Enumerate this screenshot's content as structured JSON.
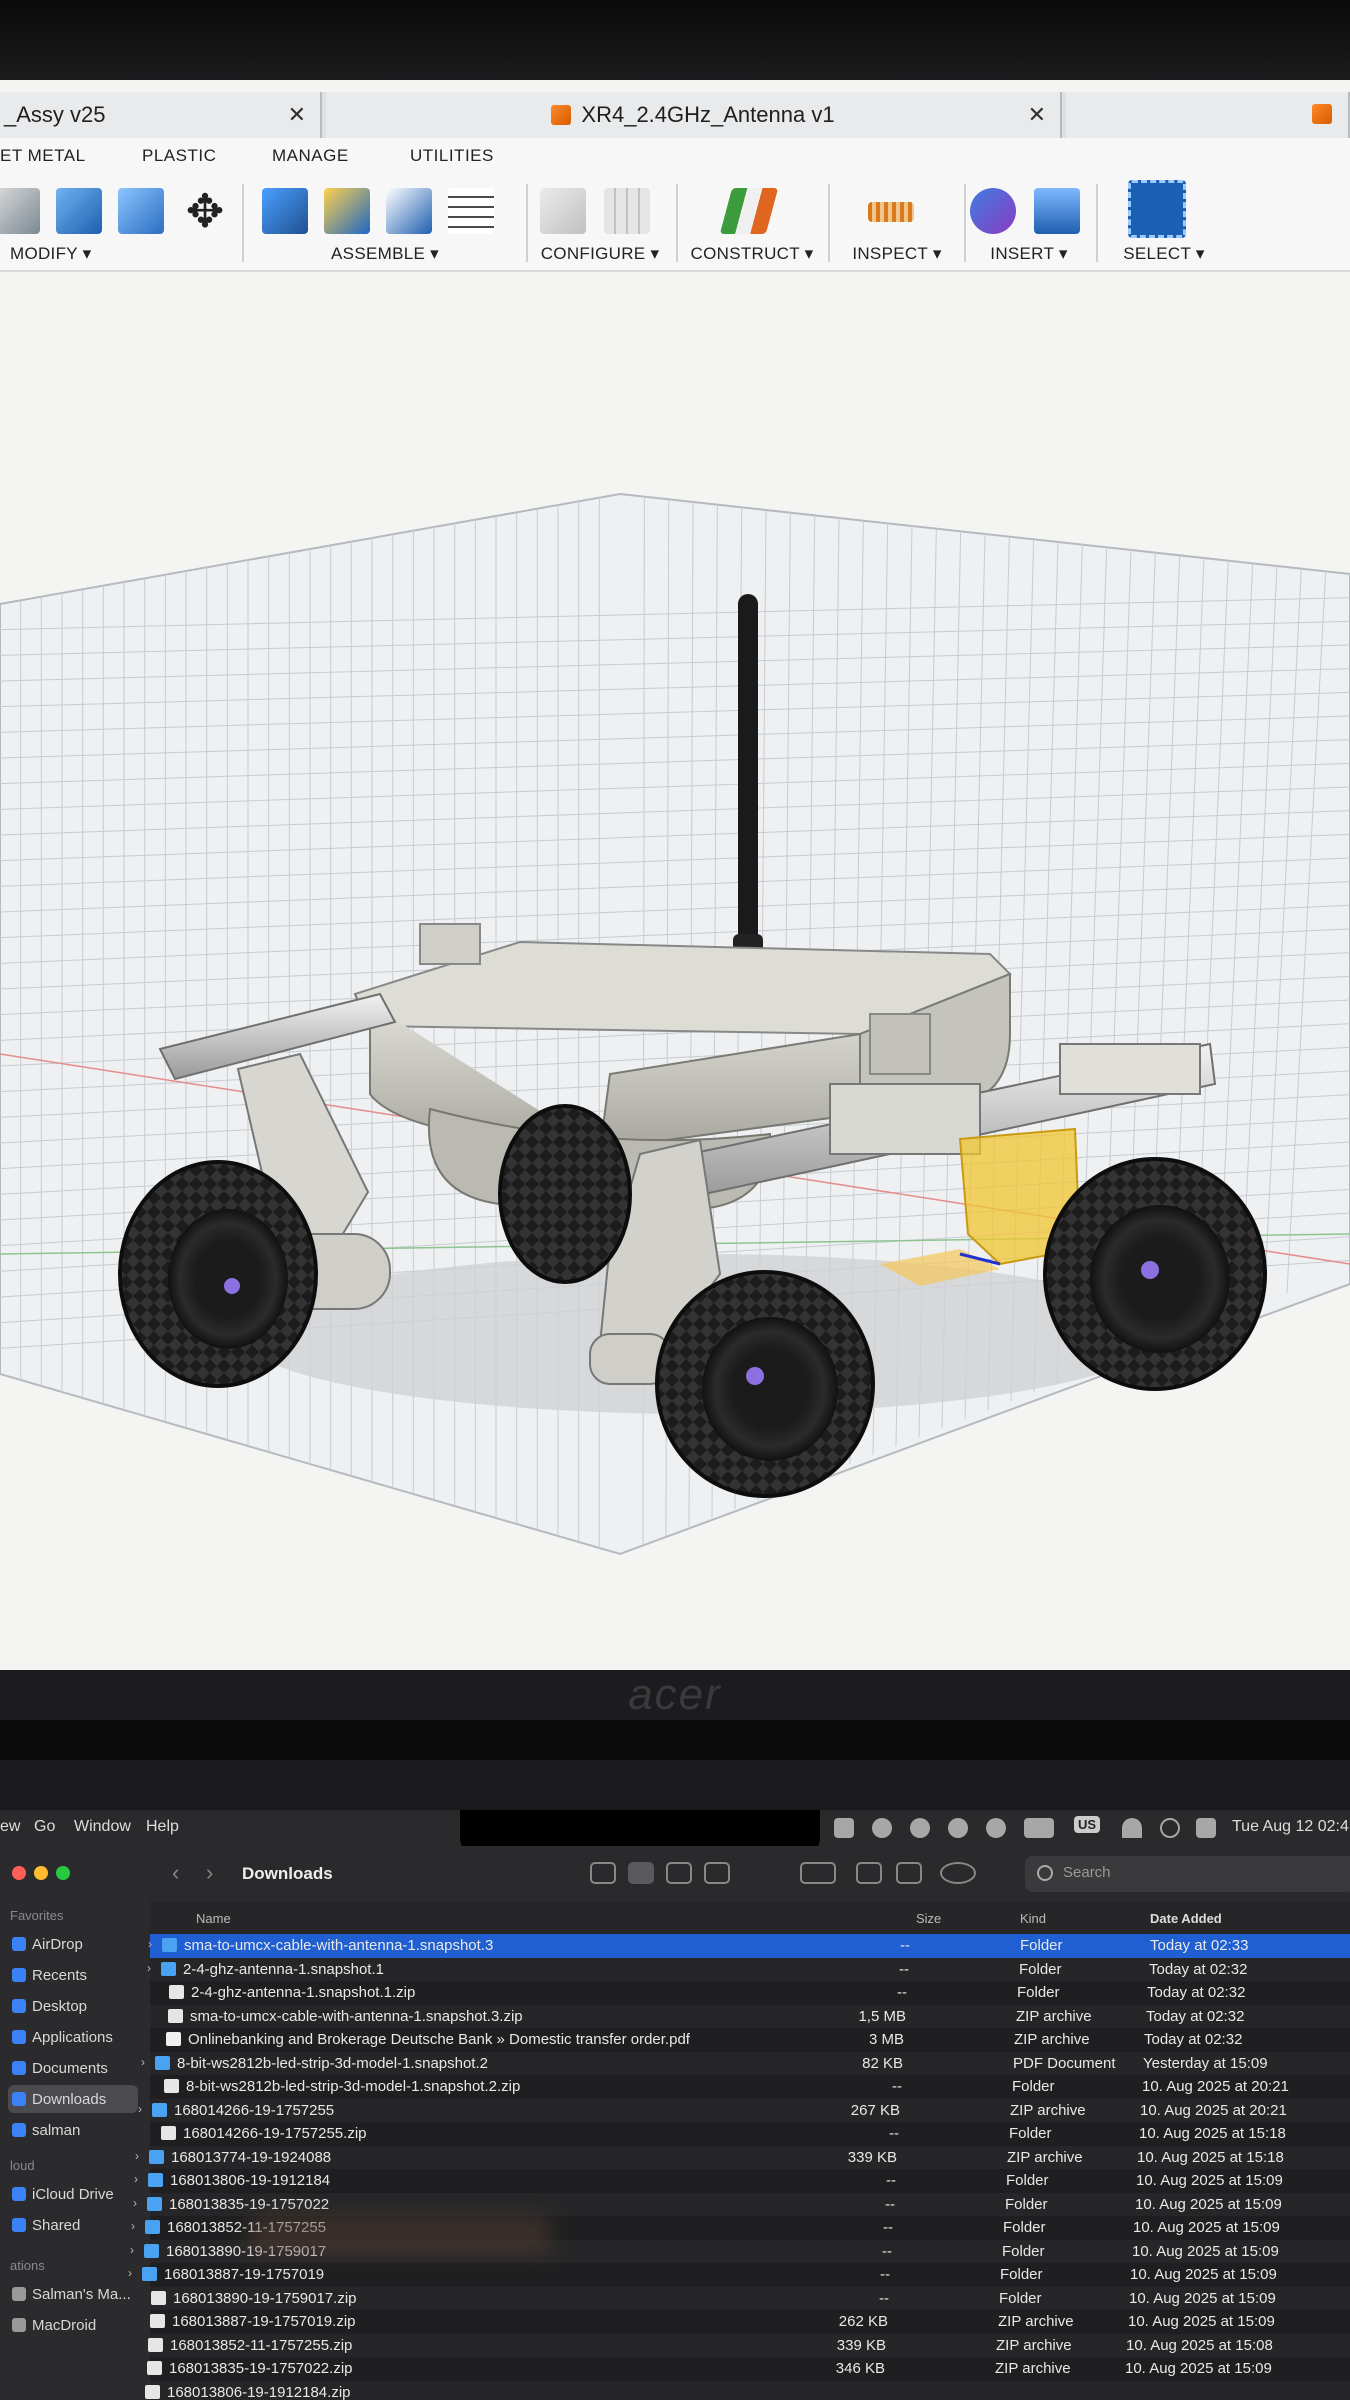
{
  "fusion": {
    "tabs": [
      {
        "title": "_Assy v25",
        "close": "✕"
      },
      {
        "title": "XR4_2.4GHz_Antenna v1",
        "close": "✕"
      }
    ],
    "toolbar_tabs": [
      "ET METAL",
      "PLASTIC",
      "MANAGE",
      "UTILITIES"
    ],
    "toolbar_groups": [
      {
        "label": "MODIFY ▾"
      },
      {
        "label": "ASSEMBLE ▾"
      },
      {
        "label": "CONFIGURE ▾"
      },
      {
        "label": "CONSTRUCT ▾"
      },
      {
        "label": "INSPECT ▾"
      },
      {
        "label": "INSERT ▾"
      },
      {
        "label": "SELECT ▾"
      }
    ],
    "accent_color": "#f07a1a",
    "select_color": "#1a5fb4"
  },
  "monitor_brand": "acer",
  "mac_menubar": {
    "items": [
      "ew",
      "Go",
      "Window",
      "Help"
    ],
    "keyboard": "US",
    "datetime": "Tue Aug 12  02:4"
  },
  "finder": {
    "title": "Downloads",
    "search_placeholder": "Search",
    "sidebar": {
      "favorites_heading": "Favorites",
      "favorites": [
        "AirDrop",
        "Recents",
        "Desktop",
        "Applications",
        "Documents",
        "Downloads",
        "salman"
      ],
      "icloud_heading": "loud",
      "icloud": [
        "iCloud Drive",
        "Shared"
      ],
      "locations_heading": "ations",
      "locations": [
        "Salman's Ma...",
        "MacDroid"
      ]
    },
    "columns": {
      "name": "Name",
      "size": "Size",
      "kind": "Kind",
      "date": "Date Added"
    },
    "files": [
      {
        "name": "sma-to-umcx-cable-with-antenna-1.snapshot.3",
        "size": "--",
        "kind": "Folder",
        "date": "Today at 02:33",
        "type": "folder",
        "selected": true
      },
      {
        "name": "2-4-ghz-antenna-1.snapshot.1",
        "size": "--",
        "kind": "Folder",
        "date": "Today at 02:32",
        "type": "folder"
      },
      {
        "name": "2-4-ghz-antenna-1.snapshot.1.zip",
        "size": "--",
        "kind": "Folder",
        "date": "Today at 02:32",
        "type": "zip"
      },
      {
        "name": "sma-to-umcx-cable-with-antenna-1.snapshot.3.zip",
        "size": "1,5 MB",
        "kind": "ZIP archive",
        "date": "Today at 02:32",
        "type": "zip"
      },
      {
        "name": "Onlinebanking and Brokerage Deutsche Bank » Domestic transfer order.pdf",
        "size": "3 MB",
        "kind": "ZIP archive",
        "date": "Today at 02:32",
        "type": "pdf"
      },
      {
        "name": "8-bit-ws2812b-led-strip-3d-model-1.snapshot.2",
        "size": "82 KB",
        "kind": "PDF Document",
        "date": "Yesterday at 15:09",
        "type": "folder"
      },
      {
        "name": "8-bit-ws2812b-led-strip-3d-model-1.snapshot.2.zip",
        "size": "--",
        "kind": "Folder",
        "date": "10. Aug 2025 at 20:21",
        "type": "zip"
      },
      {
        "name": "168014266-19-1757255",
        "size": "267 KB",
        "kind": "ZIP archive",
        "date": "10. Aug 2025 at 20:21",
        "type": "folder"
      },
      {
        "name": "168014266-19-1757255.zip",
        "size": "--",
        "kind": "Folder",
        "date": "10. Aug 2025 at 15:18",
        "type": "zip"
      },
      {
        "name": "168013774-19-1924088",
        "size": "339 KB",
        "kind": "ZIP archive",
        "date": "10. Aug 2025 at 15:18",
        "type": "folder"
      },
      {
        "name": "168013806-19-1912184",
        "size": "--",
        "kind": "Folder",
        "date": "10. Aug 2025 at 15:09",
        "type": "folder"
      },
      {
        "name": "168013835-19-1757022",
        "size": "--",
        "kind": "Folder",
        "date": "10. Aug 2025 at 15:09",
        "type": "folder"
      },
      {
        "name": "168013852-11-1757255",
        "size": "--",
        "kind": "Folder",
        "date": "10. Aug 2025 at 15:09",
        "type": "folder"
      },
      {
        "name": "168013890-19-1759017",
        "size": "--",
        "kind": "Folder",
        "date": "10. Aug 2025 at 15:09",
        "type": "folder"
      },
      {
        "name": "168013887-19-1757019",
        "size": "--",
        "kind": "Folder",
        "date": "10. Aug 2025 at 15:09",
        "type": "folder"
      },
      {
        "name": "168013890-19-1759017.zip",
        "size": "--",
        "kind": "Folder",
        "date": "10. Aug 2025 at 15:09",
        "type": "zip"
      },
      {
        "name": "168013887-19-1757019.zip",
        "size": "262 KB",
        "kind": "ZIP archive",
        "date": "10. Aug 2025 at 15:09",
        "type": "zip"
      },
      {
        "name": "168013852-11-1757255.zip",
        "size": "339 KB",
        "kind": "ZIP archive",
        "date": "10. Aug 2025 at 15:08",
        "type": "zip"
      },
      {
        "name": "168013835-19-1757022.zip",
        "size": "346 KB",
        "kind": "ZIP archive",
        "date": "10. Aug 2025 at 15:09",
        "type": "zip"
      },
      {
        "name": "168013806-19-1912184.zip",
        "size": "",
        "kind": "",
        "date": "",
        "type": "zip"
      }
    ]
  }
}
